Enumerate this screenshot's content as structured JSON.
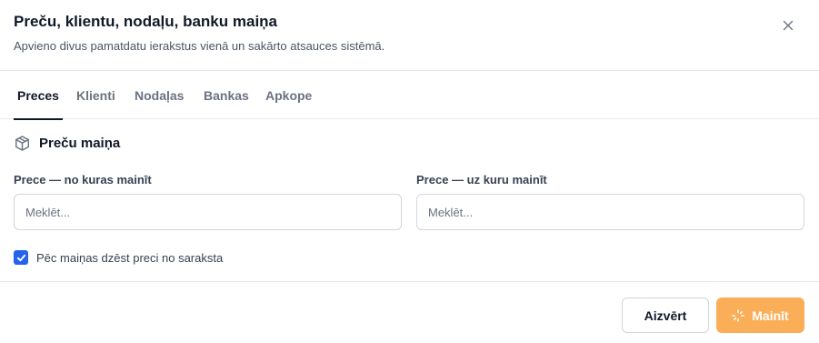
{
  "dialog": {
    "title": "Preču, klientu, nodaļu, banku maiņa",
    "subtitle": "Apvieno divus pamatdatu ierakstus vienā un sakārto atsauces sistēmā.",
    "close_icon": "close-icon"
  },
  "tabs": [
    {
      "label": "Preces",
      "active": true
    },
    {
      "label": "Klienti",
      "active": false
    },
    {
      "label": "Nodaļas",
      "active": false
    },
    {
      "label": "Bankas",
      "active": false
    },
    {
      "label": "Apkope",
      "active": false
    }
  ],
  "section": {
    "icon": "package-icon",
    "title": "Preču maiņa"
  },
  "fields": {
    "from": {
      "label": "Prece — no kuras mainīt",
      "value": "",
      "placeholder": "Meklēt..."
    },
    "to": {
      "label": "Prece — uz kuru mainīt",
      "value": "",
      "placeholder": "Meklēt..."
    }
  },
  "checkbox": {
    "label": "Pēc maiņas dzēst preci no saraksta",
    "checked": true
  },
  "footer": {
    "close_label": "Aizvērt",
    "merge_label": "Mainīt",
    "merge_icon": "loader-icon"
  },
  "colors": {
    "accent": "#2563eb",
    "merge_button": "#fbae58",
    "border": "#e5e7eb"
  }
}
